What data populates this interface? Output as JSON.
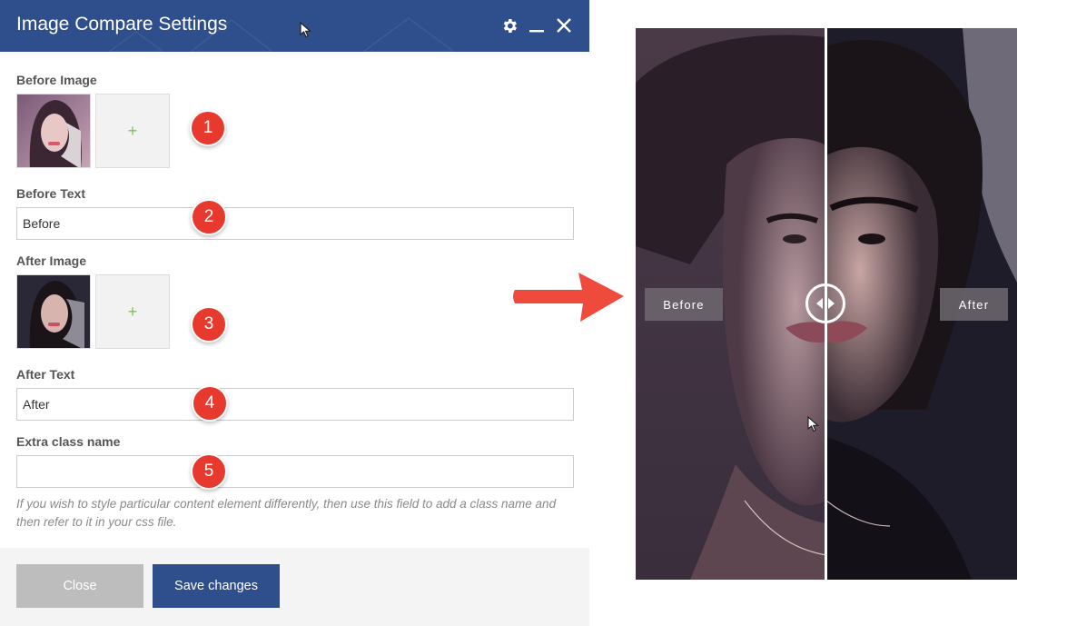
{
  "dialog": {
    "title": "Image Compare Settings",
    "before_image_label": "Before Image",
    "before_text_label": "Before Text",
    "before_text_value": "Before",
    "after_image_label": "After Image",
    "after_text_label": "After Text",
    "after_text_value": "After",
    "extra_class_label": "Extra class name",
    "extra_class_value": "",
    "add_symbol": "+",
    "help_text": "If you wish to style particular content element differently, then use this field to add a class name and then refer to it in your css file.",
    "close_label": "Close",
    "save_label": "Save changes",
    "titlebar_icons": [
      "gear-icon",
      "minimize-icon",
      "close-icon"
    ]
  },
  "badges": [
    "1",
    "2",
    "3",
    "4",
    "5"
  ],
  "preview": {
    "before_label": "Before",
    "after_label": "After"
  },
  "colors": {
    "header": "#2e4f8c",
    "save_button": "#2e4f8c",
    "close_button": "#bdbdbd",
    "badge": "#e8392e",
    "arrow": "#ee4b3c",
    "add_plus": "#7fc15a"
  }
}
